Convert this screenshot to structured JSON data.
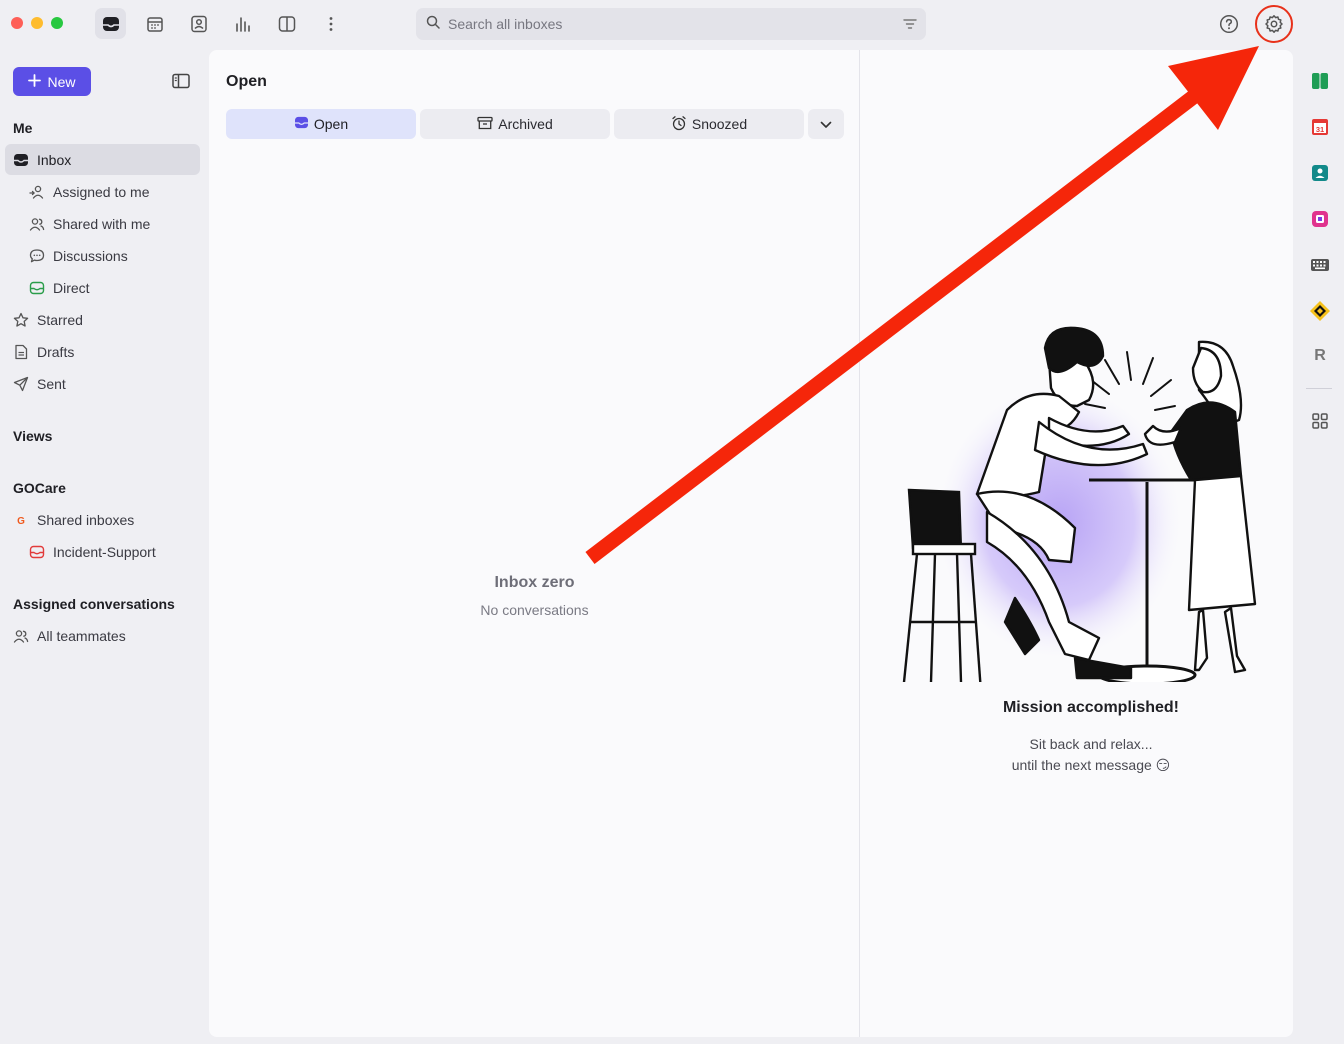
{
  "search": {
    "placeholder": "Search all inboxes"
  },
  "toolbar": {
    "new_label": "New"
  },
  "sidebar": {
    "me_title": "Me",
    "items": [
      {
        "label": "Inbox"
      },
      {
        "label": "Assigned to me"
      },
      {
        "label": "Shared with me"
      },
      {
        "label": "Discussions"
      },
      {
        "label": "Direct"
      },
      {
        "label": "Starred"
      },
      {
        "label": "Drafts"
      },
      {
        "label": "Sent"
      }
    ],
    "views_title": "Views",
    "org_title": "GOCare",
    "org_items": [
      {
        "label": "Shared inboxes"
      },
      {
        "label": "Incident-Support"
      }
    ],
    "assigned_title": "Assigned conversations",
    "assigned_items": [
      {
        "label": "All teammates"
      }
    ]
  },
  "list": {
    "title": "Open",
    "tabs": [
      {
        "label": "Open"
      },
      {
        "label": "Archived"
      },
      {
        "label": "Snoozed"
      }
    ],
    "empty_title": "Inbox zero",
    "empty_subtitle": "No conversations"
  },
  "detail": {
    "title": "Mission accomplished!",
    "line1": "Sit back and relax...",
    "line2": "until the next message 😏"
  },
  "rail": {
    "calendar_day": "31",
    "letter_app": "R"
  },
  "colors": {
    "accent": "#5b4fe6",
    "annotation": "#f5260a"
  }
}
